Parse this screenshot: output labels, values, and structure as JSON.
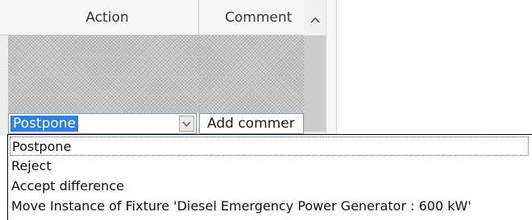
{
  "grid": {
    "columns": [
      {
        "label": "Action"
      },
      {
        "label": "Comment"
      }
    ],
    "edit_row": {
      "action_value": "Postpone",
      "comment_value": "Add commer"
    }
  },
  "dropdown": {
    "options": [
      "Postpone",
      "Reject",
      "Accept difference",
      "Move Instance of Fixture 'Diesel Emergency Power Generator : 600 kW'"
    ],
    "selected": "Postpone"
  },
  "icons": {
    "scroll_up": "chevron-up-icon",
    "dropdown": "chevron-down-icon"
  },
  "colors": {
    "selection": "#2f7fe0",
    "hatch": "#d7d7d7"
  }
}
